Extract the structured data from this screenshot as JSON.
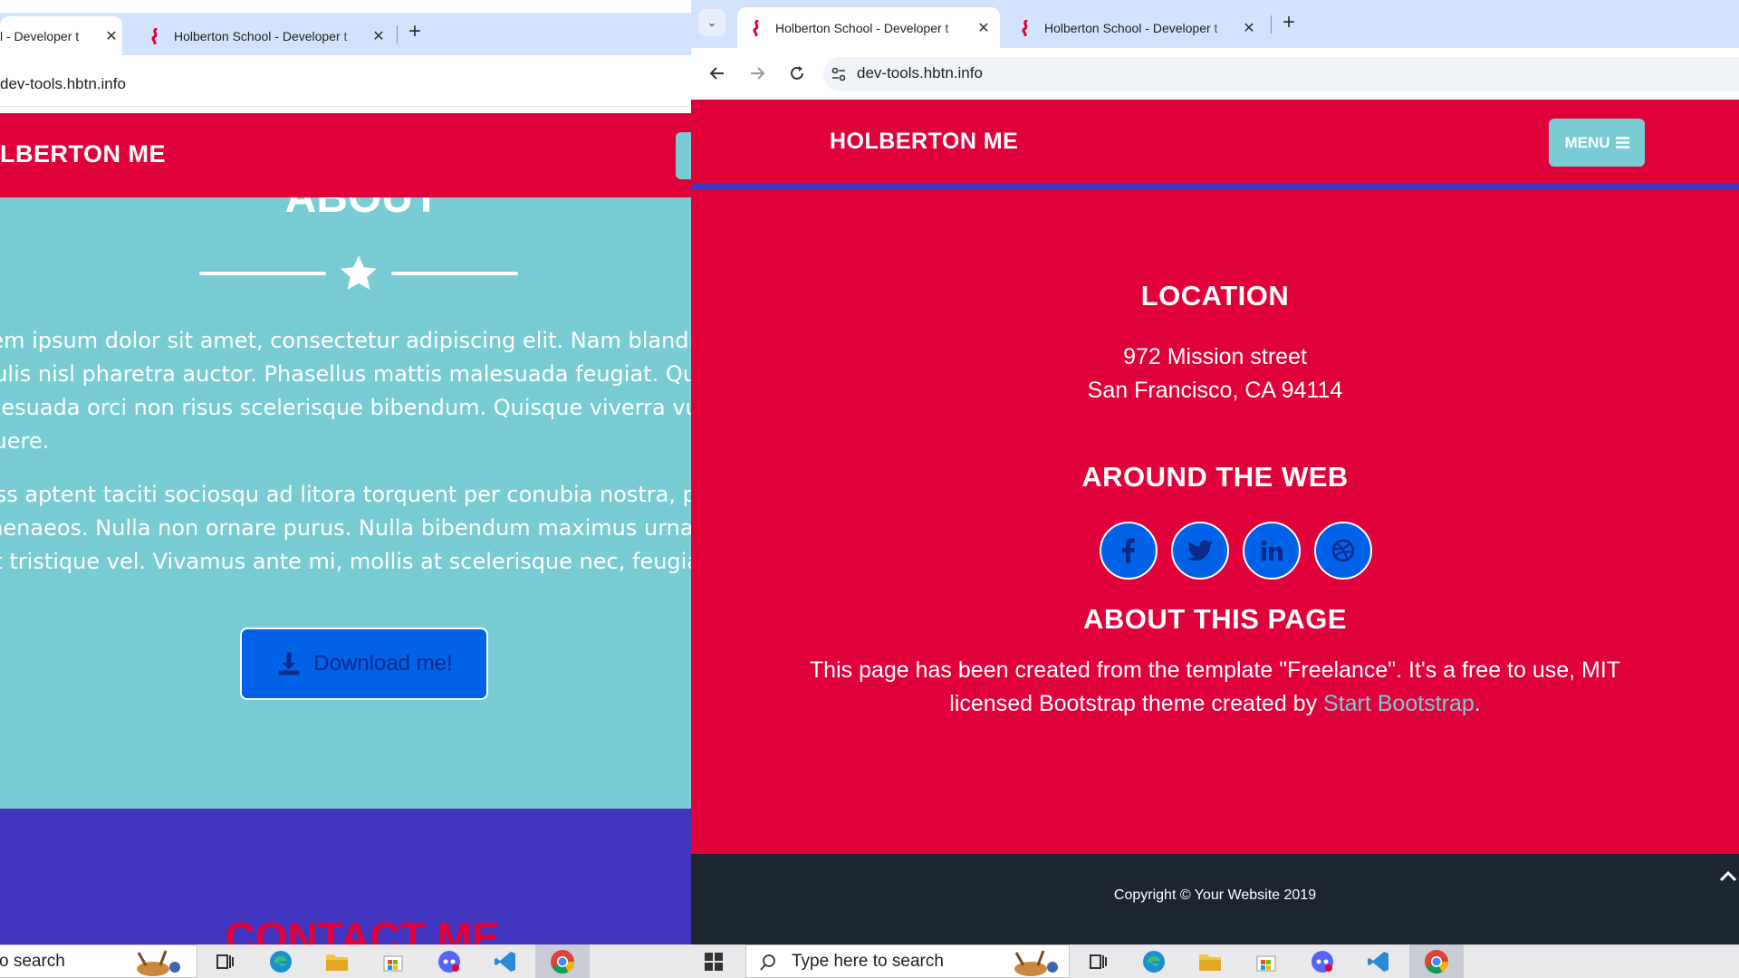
{
  "left_window": {
    "tabs": [
      {
        "title": "l - Developer t",
        "close": "✕"
      },
      {
        "title": "Holberton School - Developer t",
        "close": "✕"
      }
    ],
    "new_tab": "+",
    "url": "dev-tools.hbtn.info",
    "brand": "LBERTON ME",
    "about_title": "ABOUT",
    "paragraphs": [
      "rem ipsum dolor sit amet, consectetur adipiscing elit. Nam blandit turpi",
      "culis nisl pharetra auctor. Phasellus mattis malesuada feugiat. Quisque",
      "alesuada orci non risus scelerisque bibendum. Quisque viverra vulputat",
      "suere.",
      "ass aptent taciti sociosqu ad litora torquent per conubia nostra, per ince",
      "menaeos. Nulla non ornare purus. Nulla bibendum maximus urna, sed fi",
      "lit tristique vel. Vivamus ante mi, mollis at scelerisque nec, feugiat non c"
    ],
    "download_label": "Download me!",
    "contact_title": "CONTACT ME",
    "taskbar_search": "o search"
  },
  "right_window": {
    "tabs": [
      {
        "title": "Holberton School - Developer t",
        "close": "✕"
      },
      {
        "title": "Holberton School - Developer t",
        "close": "✕"
      }
    ],
    "new_tab": "+",
    "url": "dev-tools.hbtn.info",
    "brand": "HOLBERTON ME",
    "menu_label": "MENU",
    "location": {
      "heading": "LOCATION",
      "line1": "972 Mission street",
      "line2": "San Francisco, CA 94114"
    },
    "around_web": {
      "heading": "AROUND THE WEB",
      "icons": [
        "facebook-icon",
        "twitter-icon",
        "linkedin-icon",
        "dribbble-icon"
      ]
    },
    "about_page": {
      "heading": "ABOUT THIS PAGE",
      "line1": "This page has been created from the template \"Freelance\". It's a free to use, MIT",
      "line2_prefix": "licensed Bootstrap theme created by ",
      "link": "Start Bootstrap",
      "line2_suffix": "."
    },
    "copyright": "Copyright © Your Website 2019",
    "taskbar_search": "Type here to search"
  },
  "colors": {
    "brand_red": "#e0003a",
    "teal": "#79ccd4",
    "purple": "#4134be",
    "blue_button": "#0062e6",
    "dark_footer": "#1c2631"
  }
}
